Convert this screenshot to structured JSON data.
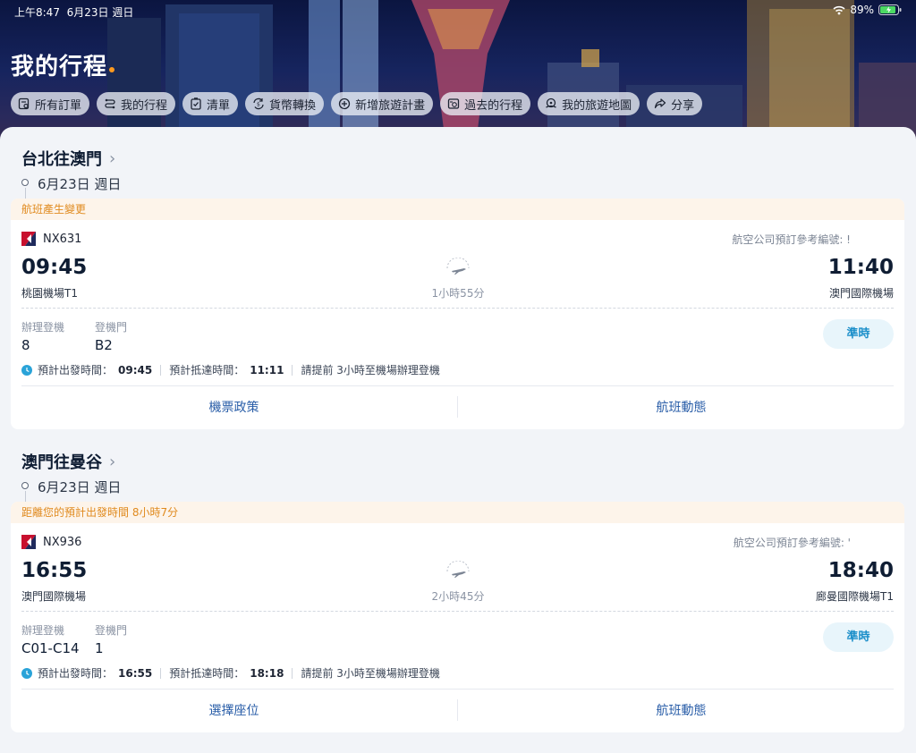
{
  "status_bar": {
    "time": "上午8:47",
    "date": "6月23日 週日",
    "battery": "89%"
  },
  "header": {
    "title": "我的行程",
    "chips": [
      {
        "label": "所有訂單",
        "icon": "orders-icon"
      },
      {
        "label": "我的行程",
        "icon": "trip-icon"
      },
      {
        "label": "清單",
        "icon": "checklist-icon"
      },
      {
        "label": "貨幣轉換",
        "icon": "currency-icon"
      },
      {
        "label": "新增旅遊計畫",
        "icon": "add-circle-icon"
      },
      {
        "label": "過去的行程",
        "icon": "history-icon"
      },
      {
        "label": "我的旅遊地圖",
        "icon": "map-icon"
      },
      {
        "label": "分享",
        "icon": "share-icon"
      }
    ]
  },
  "trips": [
    {
      "route": "台北往澳門",
      "date": "6月23日 週日",
      "notice": "航班產生變更",
      "flight_no": "NX631",
      "ref_label": "航空公司預訂參考編號: !",
      "dep_time": "09:45",
      "dep_airport": "桃園機場T1",
      "duration": "1小時55分",
      "arr_time": "11:40",
      "arr_airport": "澳門國際機場",
      "checkin_label": "辦理登機",
      "checkin_value": "8",
      "gate_label": "登機門",
      "gate_value": "B2",
      "status": "準時",
      "est_dep_label": "預計出發時間：",
      "est_dep": "09:45",
      "est_arr_label": "預計抵達時間：",
      "est_arr": "11:11",
      "advice": "請提前 3小時至機場辦理登機",
      "btn_left": "機票政策",
      "btn_right": "航班動態"
    },
    {
      "route": "澳門往曼谷",
      "date": "6月23日 週日",
      "notice": "距離您的預計出發時間 8小時7分",
      "flight_no": "NX936",
      "ref_label": "航空公司預訂參考編號: '",
      "dep_time": "16:55",
      "dep_airport": "澳門國際機場",
      "duration": "2小時45分",
      "arr_time": "18:40",
      "arr_airport": "廊曼國際機場T1",
      "checkin_label": "辦理登機",
      "checkin_value": "C01-C14",
      "gate_label": "登機門",
      "gate_value": "1",
      "status": "準時",
      "est_dep_label": "預計出發時間：",
      "est_dep": "16:55",
      "est_arr_label": "預計抵達時間：",
      "est_arr": "18:18",
      "advice": "請提前 3小時至機場辦理登機",
      "btn_left": "選擇座位",
      "btn_right": "航班動態"
    }
  ],
  "colors": {
    "accent": "#1a8ec9",
    "notice": "#e08a1e",
    "link": "#2a5ea8",
    "title_dot": "#ff9a1f"
  }
}
